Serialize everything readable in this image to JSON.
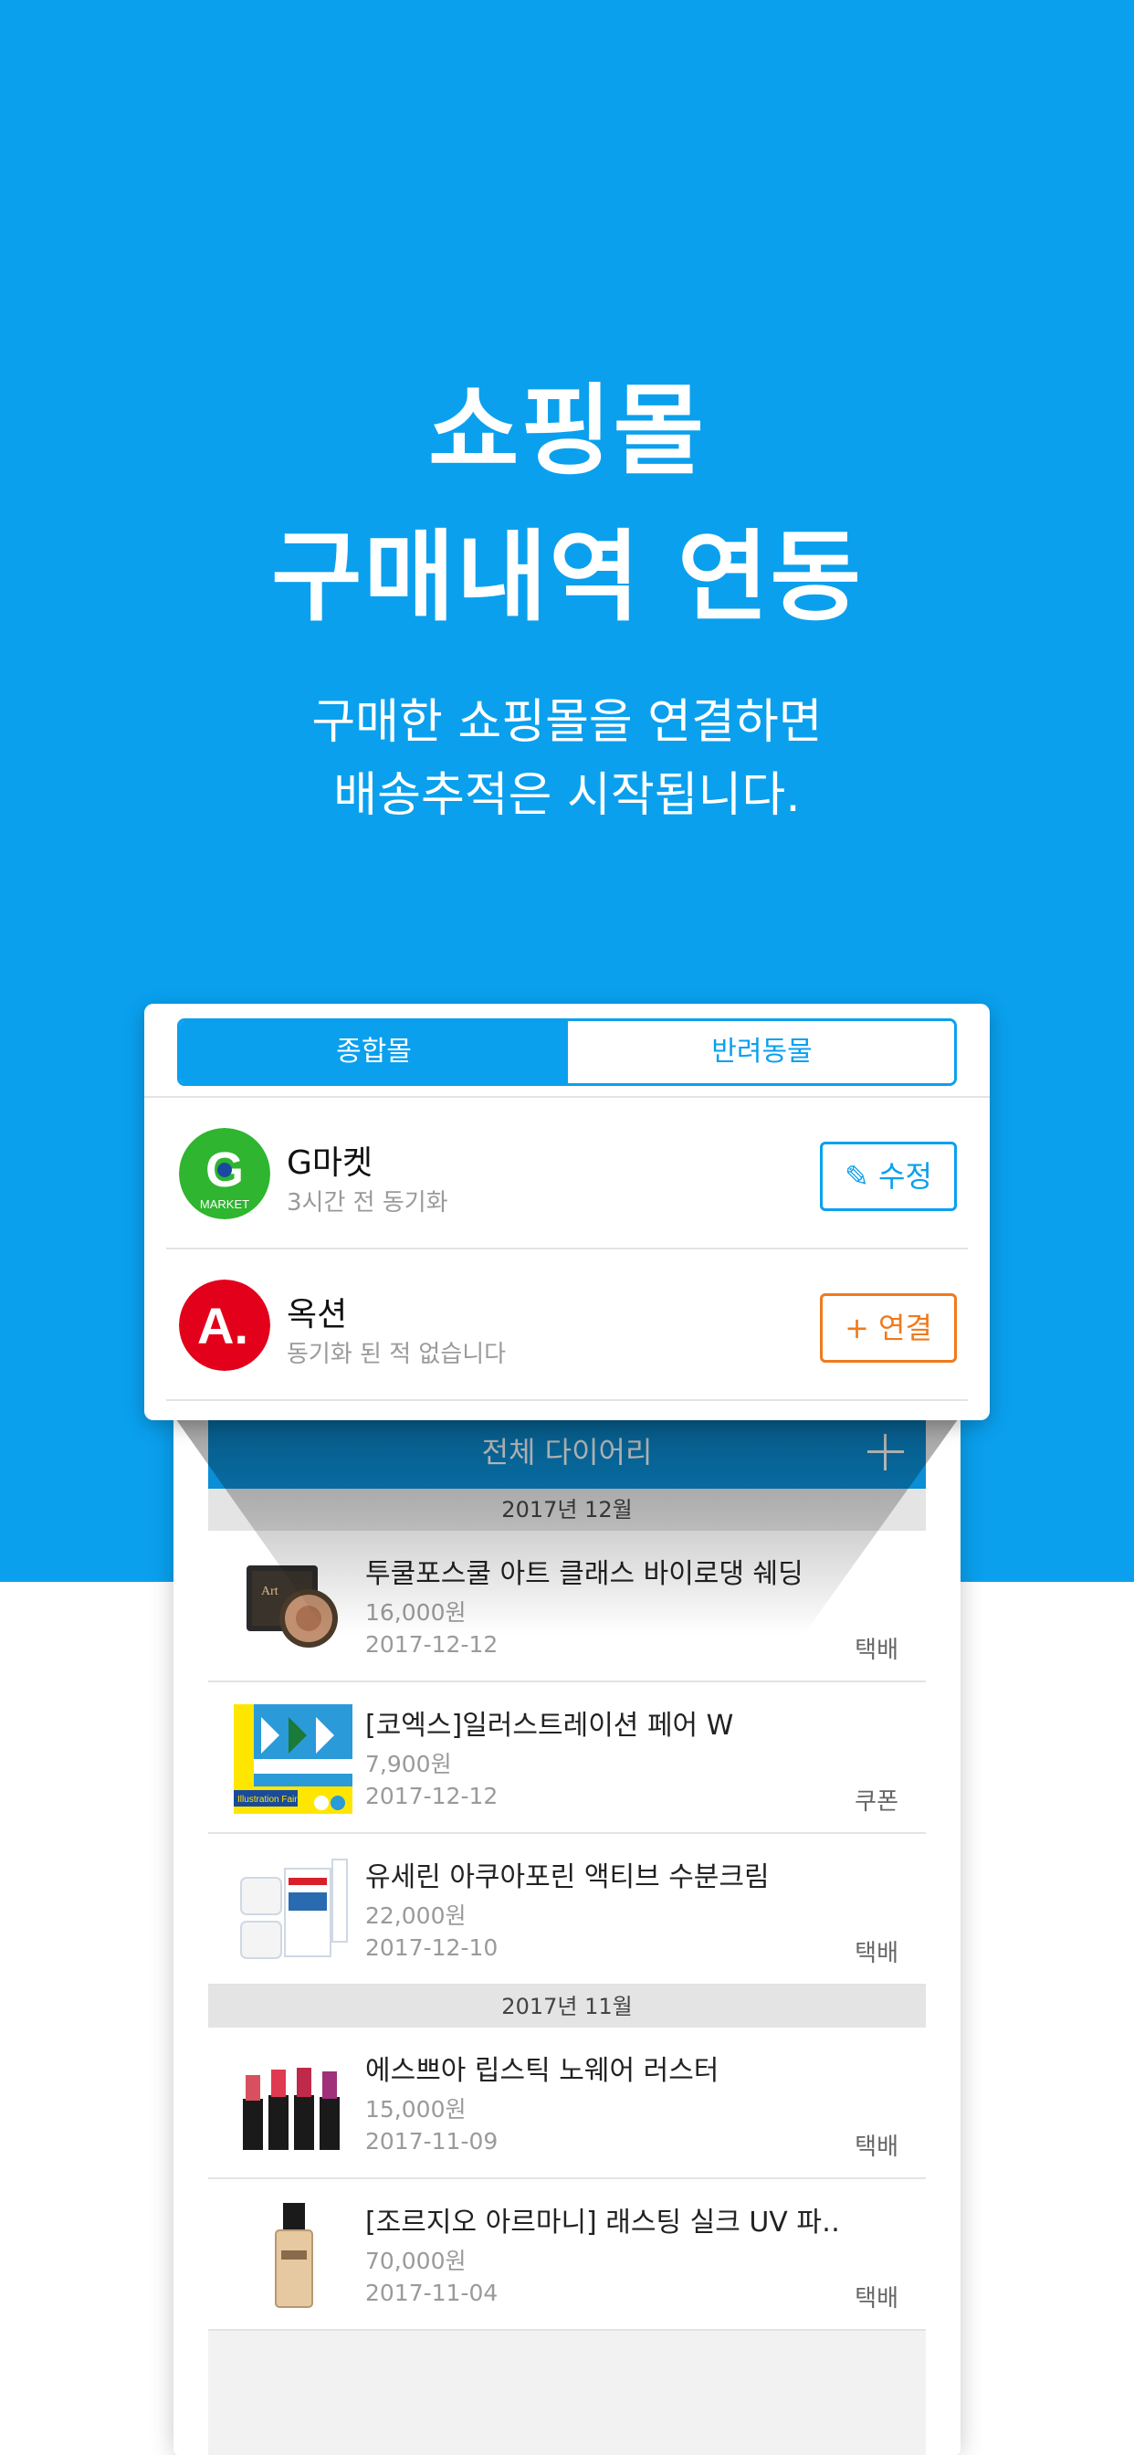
{
  "hero": {
    "title_line1": "쇼핑몰",
    "title_line2": "구매내역 연동",
    "subtitle_line1": "구매한 쇼핑몰을 연결하면",
    "subtitle_line2": "배송추적은 시작됩니다."
  },
  "tabs": {
    "general": "종합몰",
    "pet": "반려동물"
  },
  "malls": [
    {
      "name": "G마켓",
      "sync": "3시간 전 동기화",
      "button": "✎ 수정",
      "logo_text": "G",
      "logo_sub": "MARKET"
    },
    {
      "name": "옥션",
      "sync": "동기화 된 적 없습니다",
      "button": "+ 연결",
      "logo_text": "A."
    }
  ],
  "diary": {
    "title": "전체 다이어리",
    "add_icon": "plus-icon",
    "sections": [
      {
        "label": "2017년 12월"
      },
      {
        "label": "2017년 11월"
      }
    ],
    "items": [
      {
        "name": "투쿨포스쿨 아트 클래스 바이로댕 쉐딩",
        "price": "16,000원",
        "date": "2017-12-12",
        "type": "택배"
      },
      {
        "name": "[코엑스]일러스트레이션 페어 W",
        "price": "7,900원",
        "date": "2017-12-12",
        "type": "쿠폰"
      },
      {
        "name": "유세린 아쿠아포린 액티브 수분크림",
        "price": "22,000원",
        "date": "2017-12-10",
        "type": "택배"
      },
      {
        "name": "에스쁘아 립스틱 노웨어 러스터",
        "price": "15,000원",
        "date": "2017-11-09",
        "type": "택배"
      },
      {
        "name": "[조르지오 아르마니] 래스팅 실크 UV 파…",
        "price": "70,000원",
        "date": "2017-11-04",
        "type": "택배"
      }
    ]
  },
  "colors": {
    "primary": "#0aa0ee",
    "header": "#0a8fd6",
    "connect": "#f07a1c",
    "gmarket": "#2fb52f",
    "auction": "#e3001b"
  }
}
